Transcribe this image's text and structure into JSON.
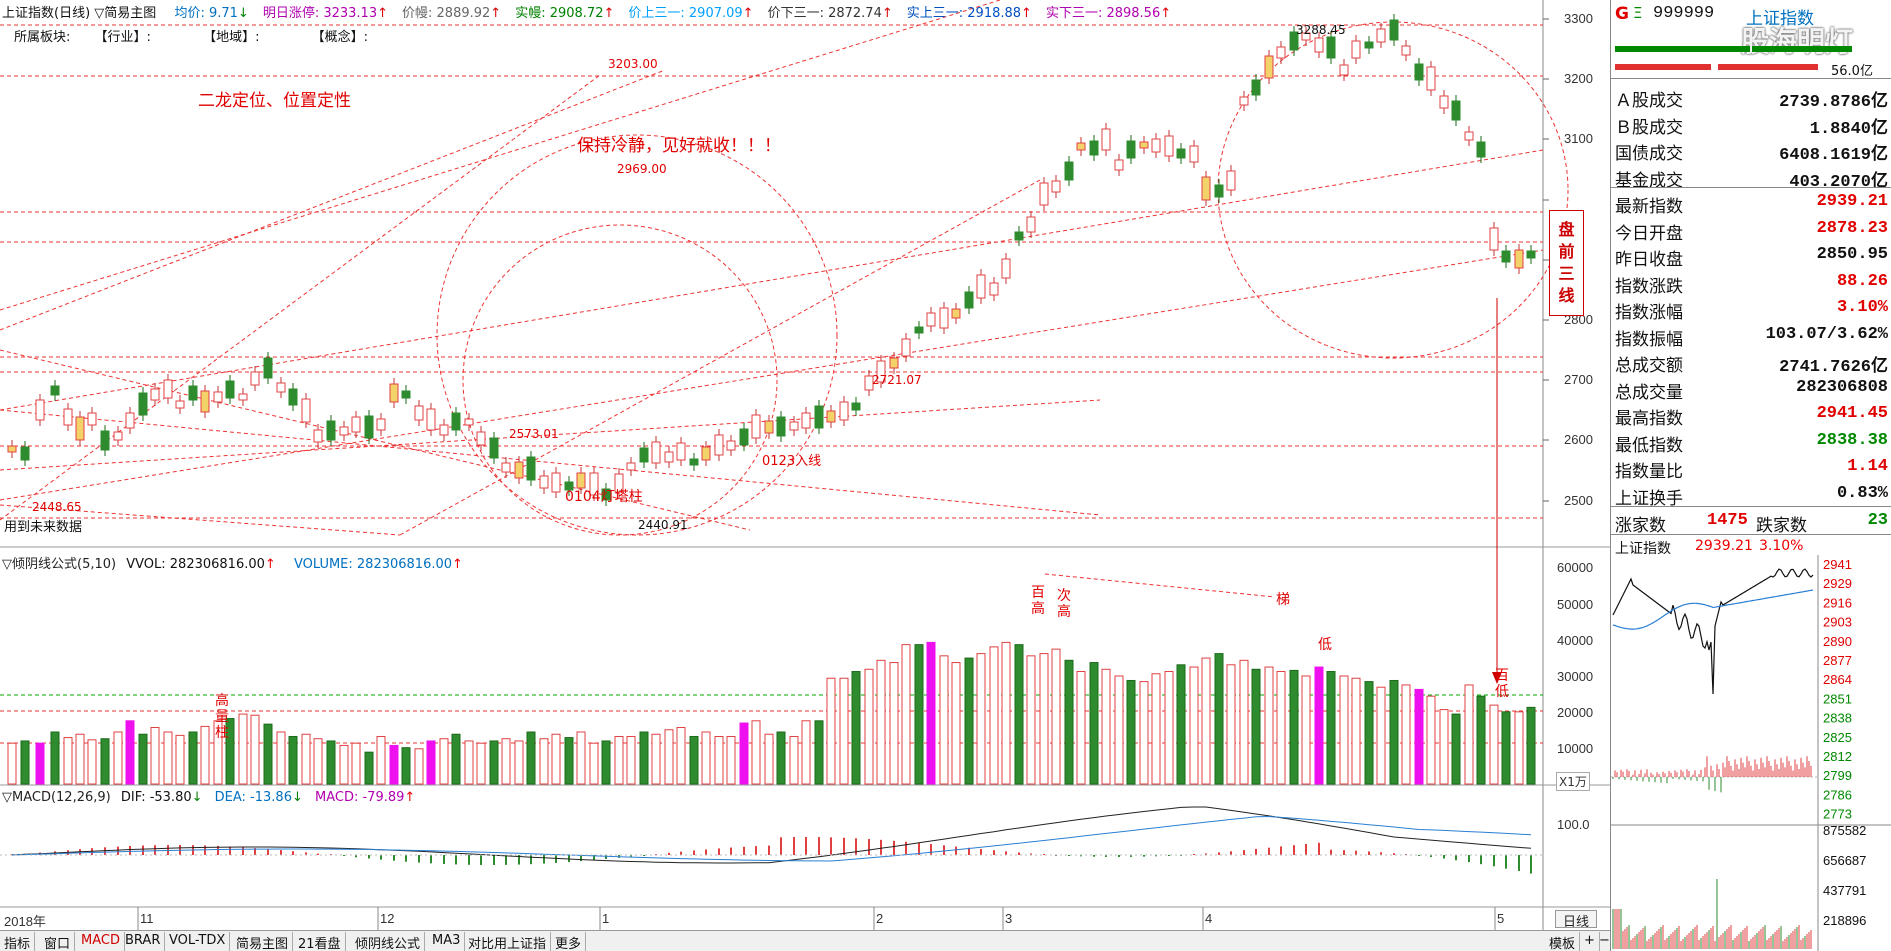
{
  "header": {
    "main_title": "上证指数(日线)",
    "indicator": "简易主图",
    "items": [
      {
        "label": "均价: 9.71",
        "arrow": "↓",
        "color": "#0070c0"
      },
      {
        "label": "明日涨停: 3233.13",
        "arrow": "↑",
        "color": "#b000b0"
      },
      {
        "label": "价幔: 2889.92",
        "arrow": "↑",
        "color": "#666666"
      },
      {
        "label": "实幔: 2908.72",
        "arrow": "↑",
        "color": "#008000"
      },
      {
        "label": "价上三一: 2907.09",
        "arrow": "↑",
        "color": "#00a0ff"
      },
      {
        "label": "价下三一: 2872.74",
        "arrow": "↑",
        "color": "#333333"
      },
      {
        "label": "实上三一: 2918.88",
        "arrow": "↑",
        "color": "#0050c0"
      },
      {
        "label": "实下三一: 2898.56",
        "arrow": "↑",
        "color": "#b000b0"
      }
    ],
    "sector_line": {
      "label": "所属板块:",
      "industry": "【行业】:",
      "region": "【地域】:",
      "concept": "【概念】:"
    }
  },
  "annotations": {
    "dragon": "二龙定位、位置定性",
    "calm": "保持冷静，见好就收！！！",
    "p3203": "3203.00",
    "p2969": "2969.00",
    "p2721": "2721.07",
    "p2573": "2573.01",
    "p0104": "0104灯塔柱",
    "p0123": "0123入线",
    "p2448": "2448.65",
    "p2440": "2440.91",
    "p3288": "3288.45",
    "future": "用到未来数据",
    "premarket": "盘前三线",
    "vol_high_volume": "高量柱",
    "vol_hundred_high": "百高",
    "vol_second_high": "次高",
    "vol_ladder": "梯",
    "vol_low": "低",
    "vol_hundred_low": "百低",
    "x1w": "X1万"
  },
  "price_axis": [
    "3300",
    "3200",
    "3100",
    "2800",
    "2700",
    "2600",
    "2500"
  ],
  "volume_panel": {
    "title": "倾阴线公式(5,10)",
    "vvol": "VVOL: 282306816.00",
    "volume": "VOLUME: 282306816.00",
    "axis": [
      "60000",
      "50000",
      "40000",
      "30000",
      "20000",
      "10000"
    ]
  },
  "macd_panel": {
    "title": "MACD(12,26,9)",
    "dif": "DIF: -53.80",
    "dea": "DEA: -13.86",
    "macd": "MACD: -79.89",
    "axis": [
      "100.0"
    ]
  },
  "x_axis": {
    "year": "2018年",
    "months": [
      "11",
      "12",
      "1",
      "2",
      "3",
      "4",
      "5"
    ],
    "day_label": "日线"
  },
  "tabs": [
    "指标",
    "窗口",
    "MACD",
    "BRAR",
    "VOL-TDX",
    "简易主图",
    "21看盘",
    "倾阴线公式",
    "MA3",
    "对比用上证指",
    "更多"
  ],
  "tabs_right": [
    "模板",
    "+",
    "−"
  ],
  "quote": {
    "code": "999999",
    "name": "上证指数",
    "watermark": "股海明灯",
    "avg_label": "56.0亿",
    "rows": [
      {
        "k": "Ａ股成交",
        "v": "2739.8786亿",
        "c": "black"
      },
      {
        "k": "Ｂ股成交",
        "v": "1.8840亿",
        "c": "black"
      },
      {
        "k": "国债成交",
        "v": "6408.1619亿",
        "c": "black"
      },
      {
        "k": "基金成交",
        "v": "403.2070亿",
        "c": "black"
      },
      {
        "k": "最新指数",
        "v": "2939.21",
        "c": "red"
      },
      {
        "k": "今日开盘",
        "v": "2878.23",
        "c": "red"
      },
      {
        "k": "昨日收盘",
        "v": "2850.95",
        "c": "black"
      },
      {
        "k": "指数涨跌",
        "v": "88.26",
        "c": "red"
      },
      {
        "k": "指数涨幅",
        "v": "3.10%",
        "c": "red"
      },
      {
        "k": "指数振幅",
        "v": "103.07/3.62%",
        "c": "black"
      },
      {
        "k": "总成交额",
        "v": "2741.7626亿",
        "c": "black"
      },
      {
        "k": "总成交量",
        "v": "282306808",
        "c": "black"
      },
      {
        "k": "最高指数",
        "v": "2941.45",
        "c": "red"
      },
      {
        "k": "最低指数",
        "v": "2838.38",
        "c": "green"
      },
      {
        "k": "指数量比",
        "v": "1.14",
        "c": "red"
      },
      {
        "k": "上证换手",
        "v": "0.83%",
        "c": "black"
      }
    ],
    "up_label": "涨家数",
    "up_value": "1475",
    "down_label": "跌家数",
    "down_value": "23",
    "mini_title": "上证指数",
    "mini_price": "2939.21",
    "mini_pct": "3.10%",
    "mini_axis": [
      "2941",
      "2929",
      "2916",
      "2903",
      "2890",
      "2877",
      "2864",
      "2851",
      "2838",
      "2825",
      "2812",
      "2799",
      "2786",
      "2773"
    ],
    "mini_vol_axis": [
      "875582",
      "656687",
      "437791",
      "218896"
    ]
  }
}
